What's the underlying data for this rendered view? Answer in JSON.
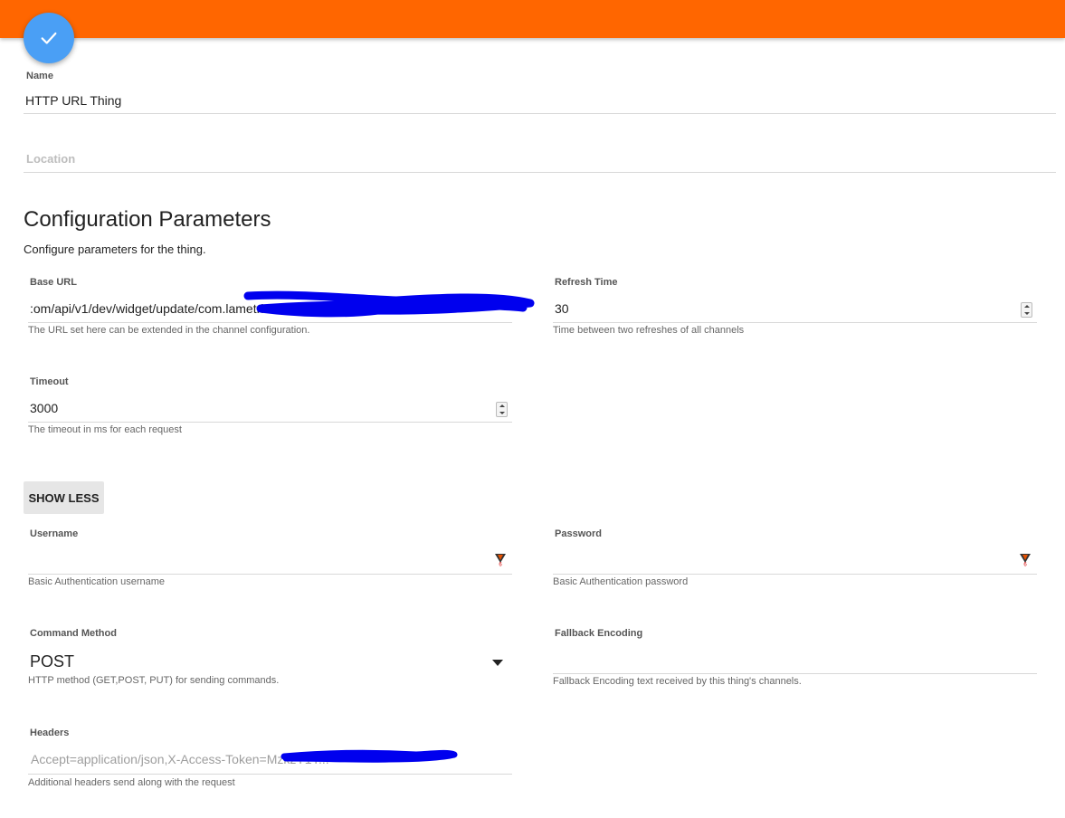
{
  "header": {
    "bar_color": "#ff6600",
    "fab_icon": "check-icon"
  },
  "name_field": {
    "label": "Name",
    "value": "HTTP URL Thing"
  },
  "location_field": {
    "placeholder": "Location"
  },
  "config": {
    "title": "Configuration Parameters",
    "subtitle": "Configure parameters for the thing."
  },
  "base_url": {
    "label": "Base URL",
    "value": ":om/api/v1/dev/widget/update/com.lametric",
    "help": "The URL set here can be extended in the channel configuration."
  },
  "refresh_time": {
    "label": "Refresh Time",
    "value": "30",
    "help": "Time between two refreshes of all channels"
  },
  "timeout": {
    "label": "Timeout",
    "value": "3000",
    "help": "The timeout in ms for each request"
  },
  "show_less_button": {
    "label": "SHOW LESS"
  },
  "username": {
    "label": "Username",
    "value": "",
    "help": "Basic Authentication username"
  },
  "password": {
    "label": "Password",
    "value": "",
    "help": "Basic Authentication password"
  },
  "command_method": {
    "label": "Command Method",
    "value": "POST",
    "help": "HTTP method (GET,POST, PUT) for sending commands."
  },
  "fallback_encoding": {
    "label": "Fallback Encoding",
    "value": "",
    "help": "Fallback Encoding text received by this thing's channels."
  },
  "headers": {
    "label": "Headers",
    "value": "Accept=application/json,X-Access-Token=MzkzY1Y...",
    "help": "Additional headers send along with the request"
  },
  "redaction_color": "#0000ee"
}
